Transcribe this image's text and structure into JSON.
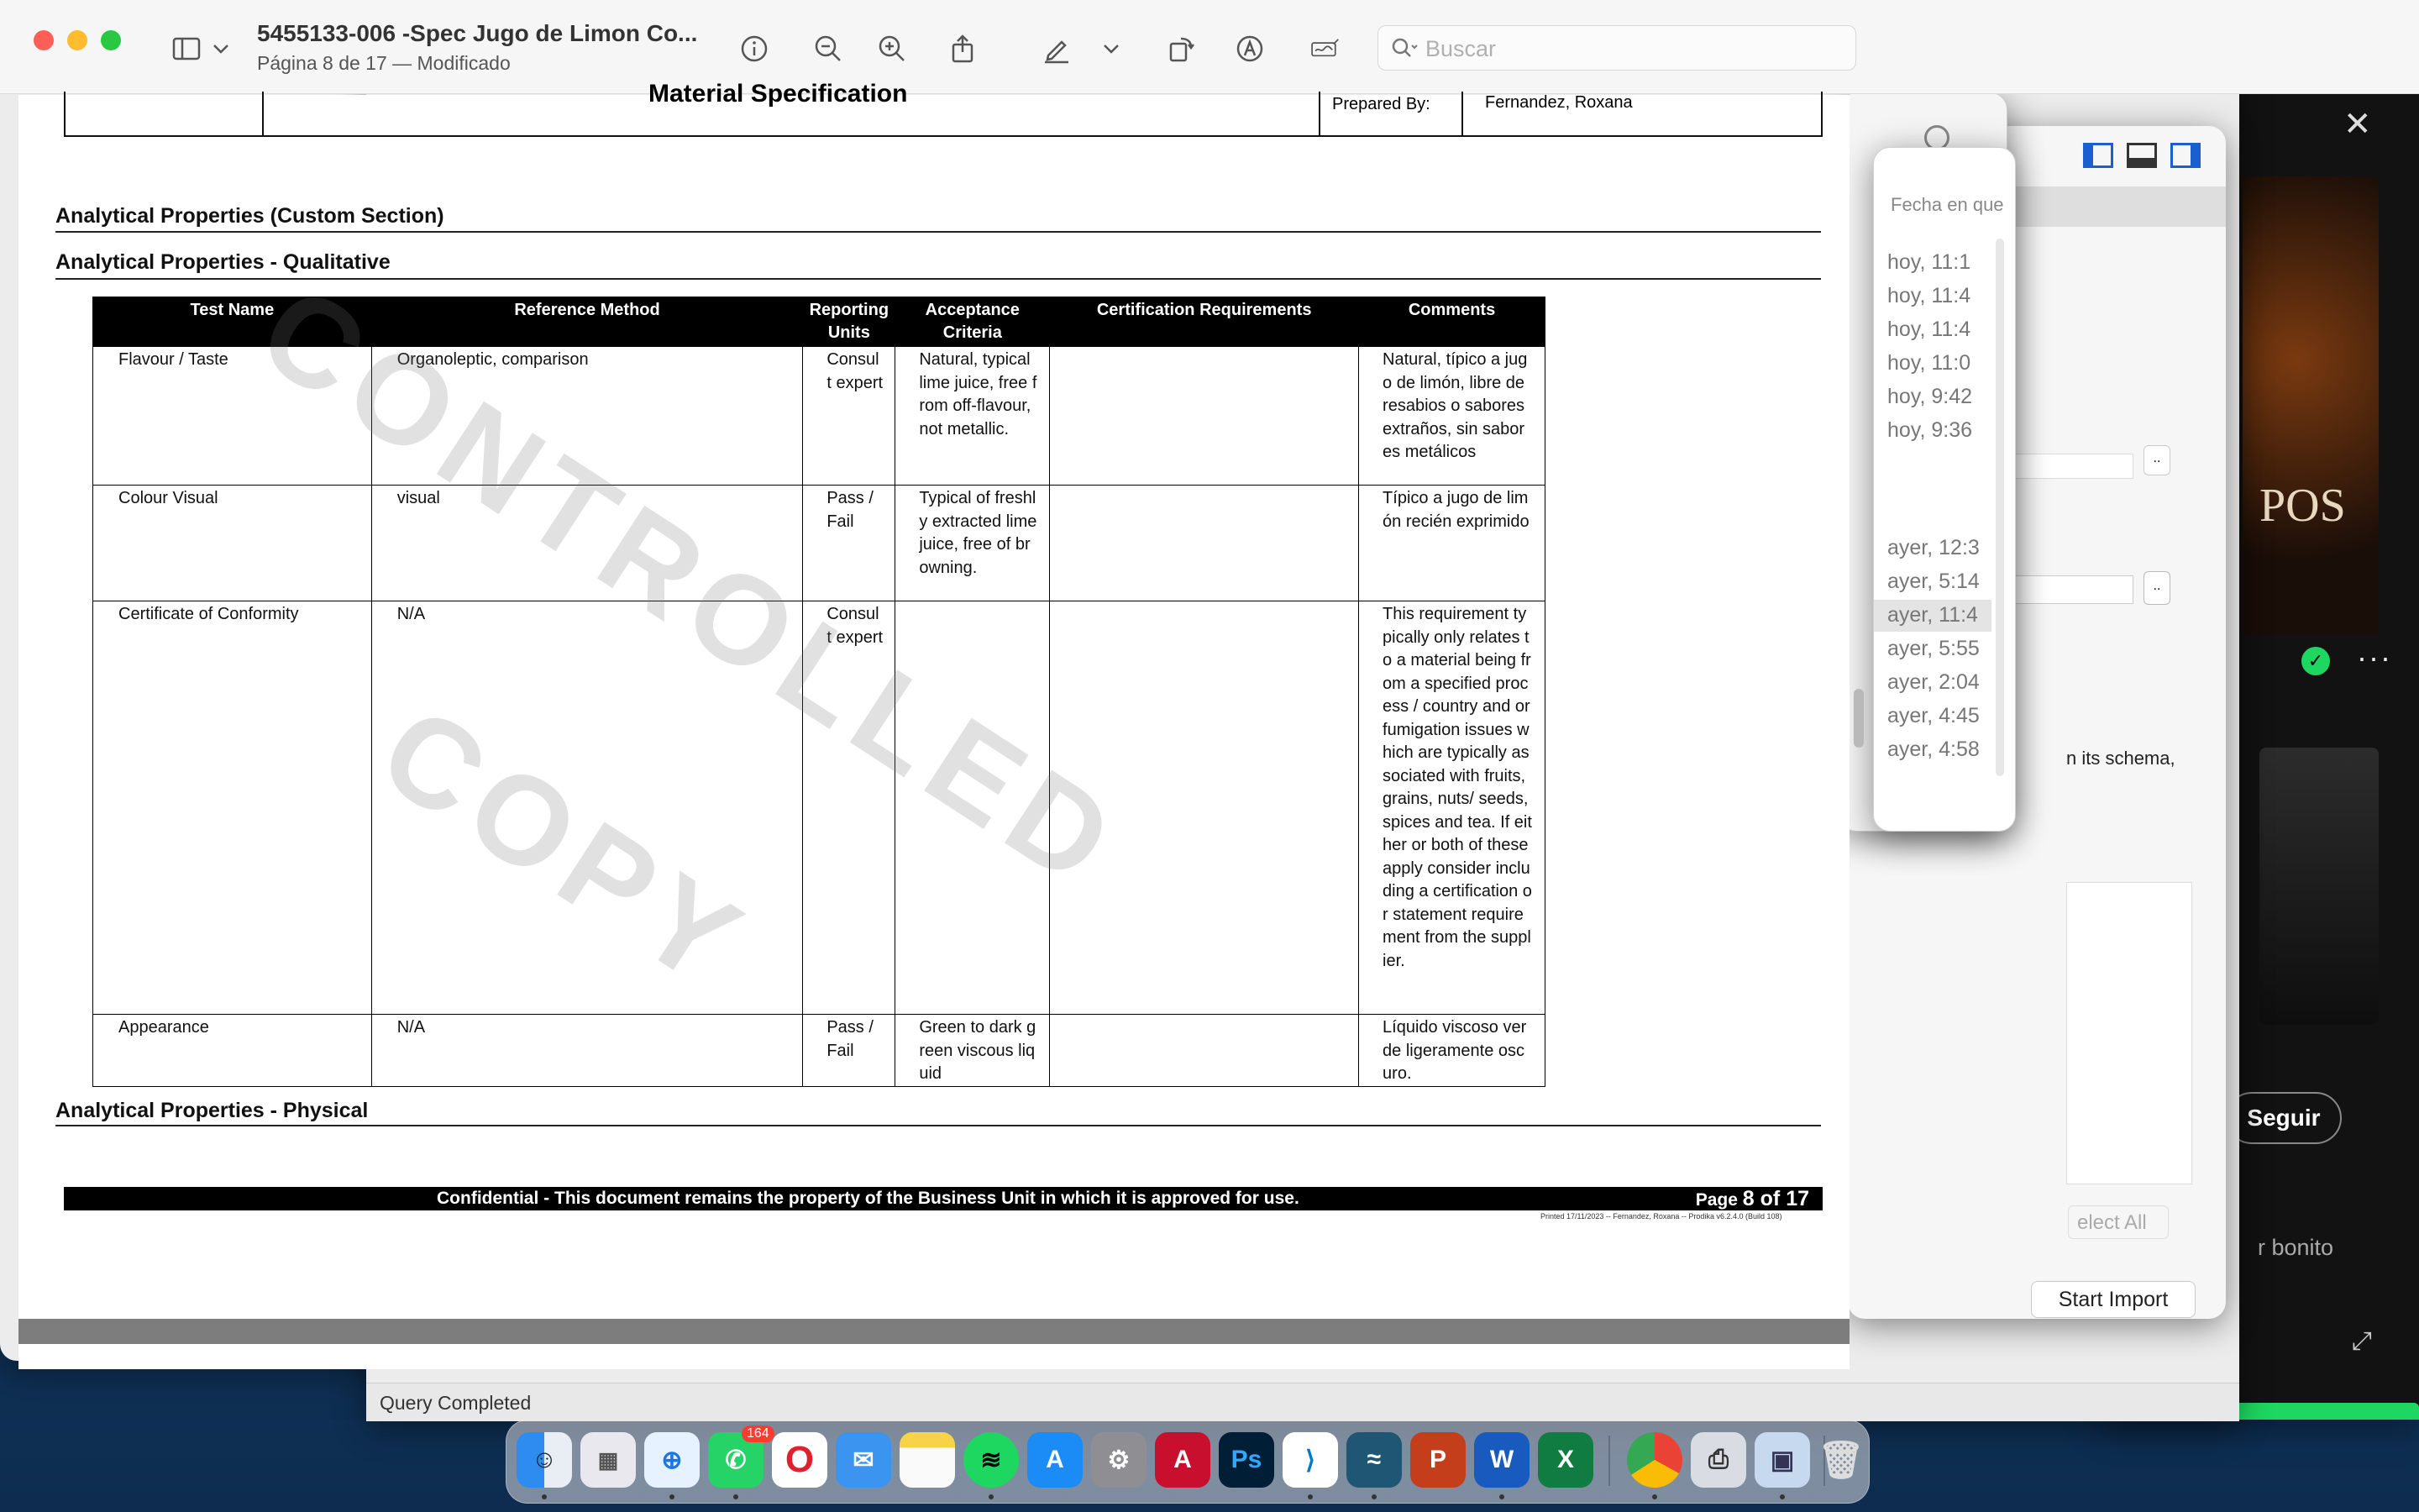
{
  "preview": {
    "title": "5455133-006 -Spec Jugo de Limon Co...",
    "subtitle": "Página 8 de 17 — Modificado",
    "search_placeholder": "Buscar"
  },
  "document": {
    "header_prepared_label": "Prepared By:",
    "header_prepared_value": "Fernandez, Roxana",
    "header_center": "Material Specification",
    "section_custom": "Analytical Properties (Custom Section)",
    "section_qualitative": "Analytical Properties - Qualitative",
    "section_physical": "Analytical Properties - Physical",
    "columns": [
      "Test Name",
      "Reference Method",
      "Reporting Units",
      "Acceptance Criteria",
      "Certification Requirements",
      "Comments"
    ],
    "rows": [
      {
        "test": "Flavour / Taste",
        "method": "Organoleptic, comparison",
        "units": "Consult expert",
        "criteria": "Natural, typical lime juice, free from off-flavour, not metallic.",
        "cert": "",
        "comments": "Natural, típico a jugo de limón, libre de resabios o sabores extraños, sin sabores metálicos"
      },
      {
        "test": "Colour Visual",
        "method": "visual",
        "units": "Pass / Fail",
        "criteria": "Typical of freshly extracted lime juice, free of browning.",
        "cert": "",
        "comments": "Típico a jugo de limón recién exprimido"
      },
      {
        "test": "Certificate of Conformity",
        "method": "N/A",
        "units": "Consult expert",
        "criteria": "",
        "cert": "",
        "comments": "This requirement typically only relates to a material being from a specified process / country   and or fumigation issues which are typically associated with fruits, grains, nuts/ seeds, spices and tea. If either or both of these apply consider including a certification or statement requirement from the supplier."
      },
      {
        "test": "Appearance",
        "method": "N/A",
        "units": "Pass / Fail",
        "criteria": "Green to dark green viscous liquid",
        "cert": "",
        "comments": "Líquido viscoso verde ligeramente oscuro."
      }
    ],
    "watermark_1": "CONTROLLED",
    "watermark_2": "COPY",
    "footer_text": "Confidential -  This document remains the property of the Business Unit in which it is approved for use.",
    "footer_page_prefix": "Page",
    "footer_page_num": "8 of 17",
    "printed_line": "Printed 17/11/2023 -- Fernandez, Roxana -- Prodika v6.2.4.0 (Build 108)"
  },
  "background": {
    "find_placeholder": "Fecha en que",
    "times": [
      "hoy, 11:1",
      "hoy, 11:4",
      "hoy, 11:4",
      "hoy, 11:0",
      "hoy, 9:42",
      "hoy, 9:36",
      "ayer, 12:3",
      "ayer, 5:14",
      "ayer, 11:4",
      "ayer, 5:55",
      "ayer, 2:04",
      "ayer, 4:45",
      "ayer, 4:58"
    ],
    "schema_text": "n its schema,",
    "select_all": "elect All",
    "start_import": "Start Import",
    "status": "Query Completed",
    "follow": "Seguir",
    "bonito": "r bonito",
    "album_text": "POS",
    "phone": "one",
    "dock_badge": "164"
  }
}
